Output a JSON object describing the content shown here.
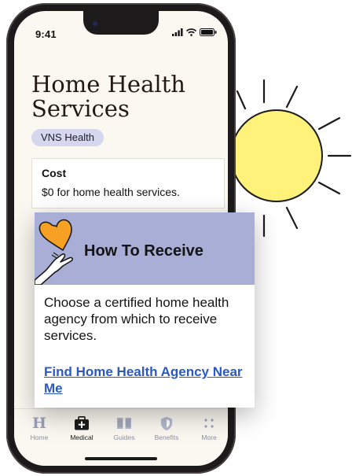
{
  "status_bar": {
    "time": "9:41"
  },
  "page": {
    "title": "Home Health Services",
    "provider_badge": "VNS Health"
  },
  "cost": {
    "heading": "Cost",
    "text": "$0 for home health services."
  },
  "how_to_receive": {
    "heading": "How To Receive",
    "body": "Choose a certified home health agency from which to receive services.",
    "link_text": "Find Home Health Agency Near Me"
  },
  "tab_bar": {
    "home_glyph": "H",
    "items": [
      {
        "label": "Home",
        "icon": "home-h-icon",
        "active": false
      },
      {
        "label": "Medical",
        "icon": "medical-kit-icon",
        "active": true
      },
      {
        "label": "Guides",
        "icon": "book-icon",
        "active": false
      },
      {
        "label": "Benefits",
        "icon": "shield-icon",
        "active": false
      },
      {
        "label": "More",
        "icon": "dots-grid-icon",
        "active": false
      }
    ]
  },
  "colors": {
    "screen_bg": "#fbf7f1",
    "badge_bg": "#d5d7ee",
    "card_header": "#a9aed6",
    "link": "#2b59c3",
    "sun_fill": "#fff27a",
    "heart": "#f6a123",
    "tab_inactive": "#8c8f9f"
  }
}
